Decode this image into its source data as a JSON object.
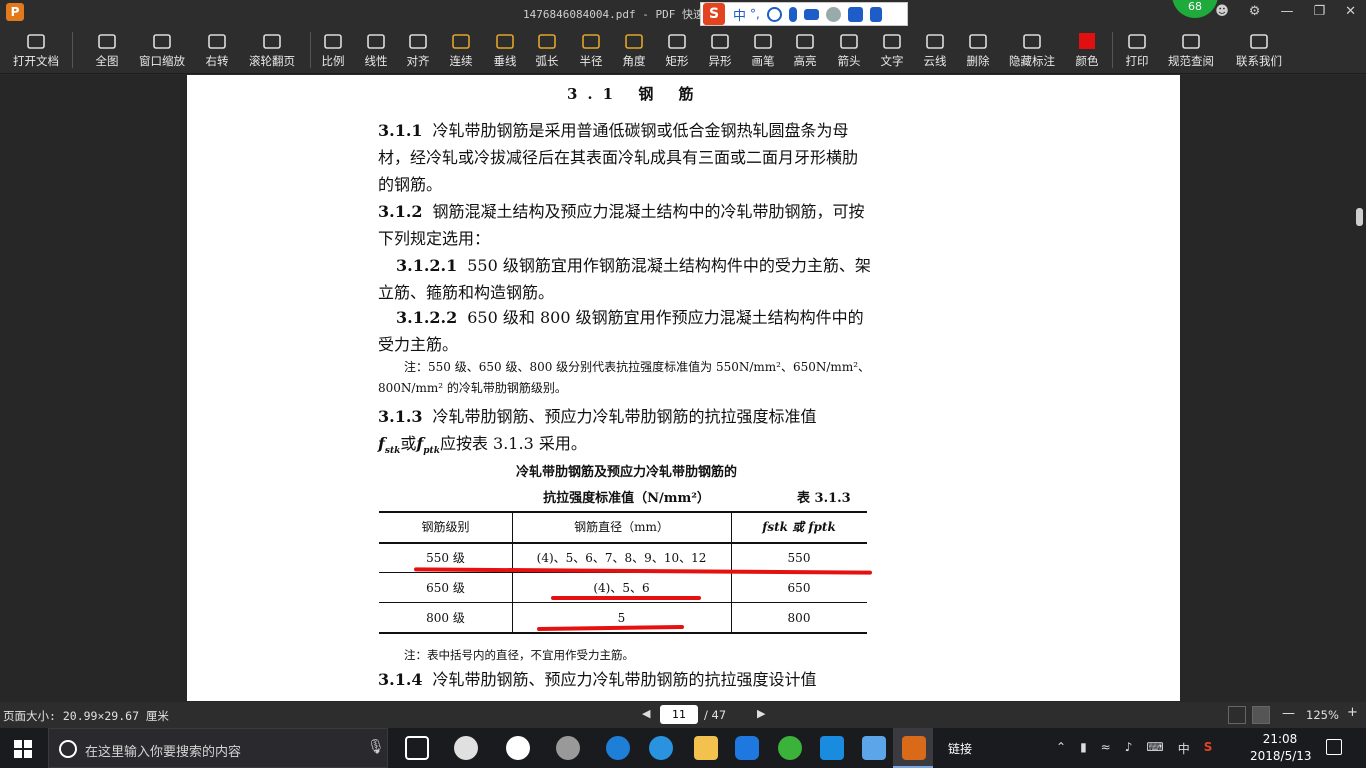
{
  "titlebar": {
    "title": "1476846084004.pdf - PDF 快速看",
    "ime_mode": "中",
    "ime_punct": "°,",
    "badge": "68"
  },
  "toolbar": {
    "items": [
      {
        "label": "打开文档",
        "icon": "folder-icon"
      },
      {
        "label": "全图",
        "icon": "fit-icon"
      },
      {
        "label": "窗口缩放",
        "icon": "zoom-icon"
      },
      {
        "label": "右转",
        "icon": "rotate-icon"
      },
      {
        "label": "滚轮翻页",
        "icon": "mouse-icon"
      },
      {
        "label": "比例",
        "icon": "ruler-icon"
      },
      {
        "label": "线性",
        "icon": "linear-icon"
      },
      {
        "label": "对齐",
        "icon": "align-icon"
      },
      {
        "label": "连续",
        "icon": "continuous-icon"
      },
      {
        "label": "垂线",
        "icon": "perpendicular-icon"
      },
      {
        "label": "弧长",
        "icon": "arc-icon"
      },
      {
        "label": "半径",
        "icon": "radius-icon"
      },
      {
        "label": "角度",
        "icon": "angle-icon"
      },
      {
        "label": "矩形",
        "icon": "rectangle-icon"
      },
      {
        "label": "异形",
        "icon": "polygon-icon"
      },
      {
        "label": "画笔",
        "icon": "pen-icon"
      },
      {
        "label": "高亮",
        "icon": "highlight-icon"
      },
      {
        "label": "箭头",
        "icon": "arrow-icon"
      },
      {
        "label": "文字",
        "icon": "text-icon"
      },
      {
        "label": "云线",
        "icon": "cloud-icon"
      },
      {
        "label": "删除",
        "icon": "eraser-icon"
      },
      {
        "label": "隐藏标注",
        "icon": "hide-icon"
      },
      {
        "label": "颜色",
        "icon": "color-icon"
      },
      {
        "label": "打印",
        "icon": "print-icon"
      },
      {
        "label": "规范查阅",
        "icon": "book-icon"
      },
      {
        "label": "联系我们",
        "icon": "contact-icon"
      }
    ],
    "color_swatch": "#e01010"
  },
  "document": {
    "section_title": "3.1 钢 筋",
    "p1_num": "3.1.1",
    "p1_text": "冷轧带肋钢筋是采用普通低碳钢或低合金钢热轧圆盘条为母材，经冷轧或冷拔减径后在其表面冷轧成具有三面或二面月牙形横肋的钢筋。",
    "p2_num": "3.1.2",
    "p2_text": "钢筋混凝土结构及预应力混凝土结构中的冷轧带肋钢筋，可按下列规定选用：",
    "p3_num": "3.1.2.1",
    "p3_text": "550 级钢筋宜用作钢筋混凝土结构构件中的受力主筋、架立筋、箍筋和构造钢筋。",
    "p4_num": "3.1.2.2",
    "p4_text": "650 级和 800 级钢筋宜用作预应力混凝土结构构件中的受力主筋。",
    "note1": "注：550 级、650 级、800 级分别代表抗拉强度标准值为 550N/mm²、650N/mm²、800N/mm² 的冷轧带肋钢筋级别。",
    "p5_num": "3.1.3",
    "p5_text_a": "冷轧带肋钢筋、预应力冷轧带肋钢筋的抗拉强度标准值",
    "p5_text_b": "或",
    "p5_text_c": "应按表 3.1.3 采用。",
    "sym1": "f",
    "sym1_sub": "stk",
    "sym2": "f",
    "sym2_sub": "ptk",
    "table_title1": "冷轧带肋钢筋及预应力冷轧带肋钢筋的",
    "table_title2": "抗拉强度标准值（N/mm²）",
    "table_ref": "表 3.1.3",
    "table_headers": [
      "钢筋级别",
      "钢筋直径（mm）",
      "fstk 或 fptk"
    ],
    "table_rows": [
      [
        "550 级",
        "(4)、5、6、7、8、9、10、12",
        "550"
      ],
      [
        "650 级",
        "(4)、5、6",
        "650"
      ],
      [
        "800 级",
        "5",
        "800"
      ]
    ],
    "note2": "注：表中括号内的直径，不宜用作受力主筋。",
    "p6_num": "3.1.4",
    "p6_text": "冷轧带肋钢筋、预应力冷轧带肋钢筋的抗拉强度设计值"
  },
  "statusbar": {
    "page_size": "页面大小: 20.99×29.67 厘米",
    "current_page": "11",
    "total_pages": "/ 47",
    "zoom": "125%"
  },
  "taskbar": {
    "search_placeholder": "在这里输入你要搜索的内容",
    "link_label": "链接",
    "ime": "中",
    "time": "21:08",
    "date": "2018/5/13"
  }
}
